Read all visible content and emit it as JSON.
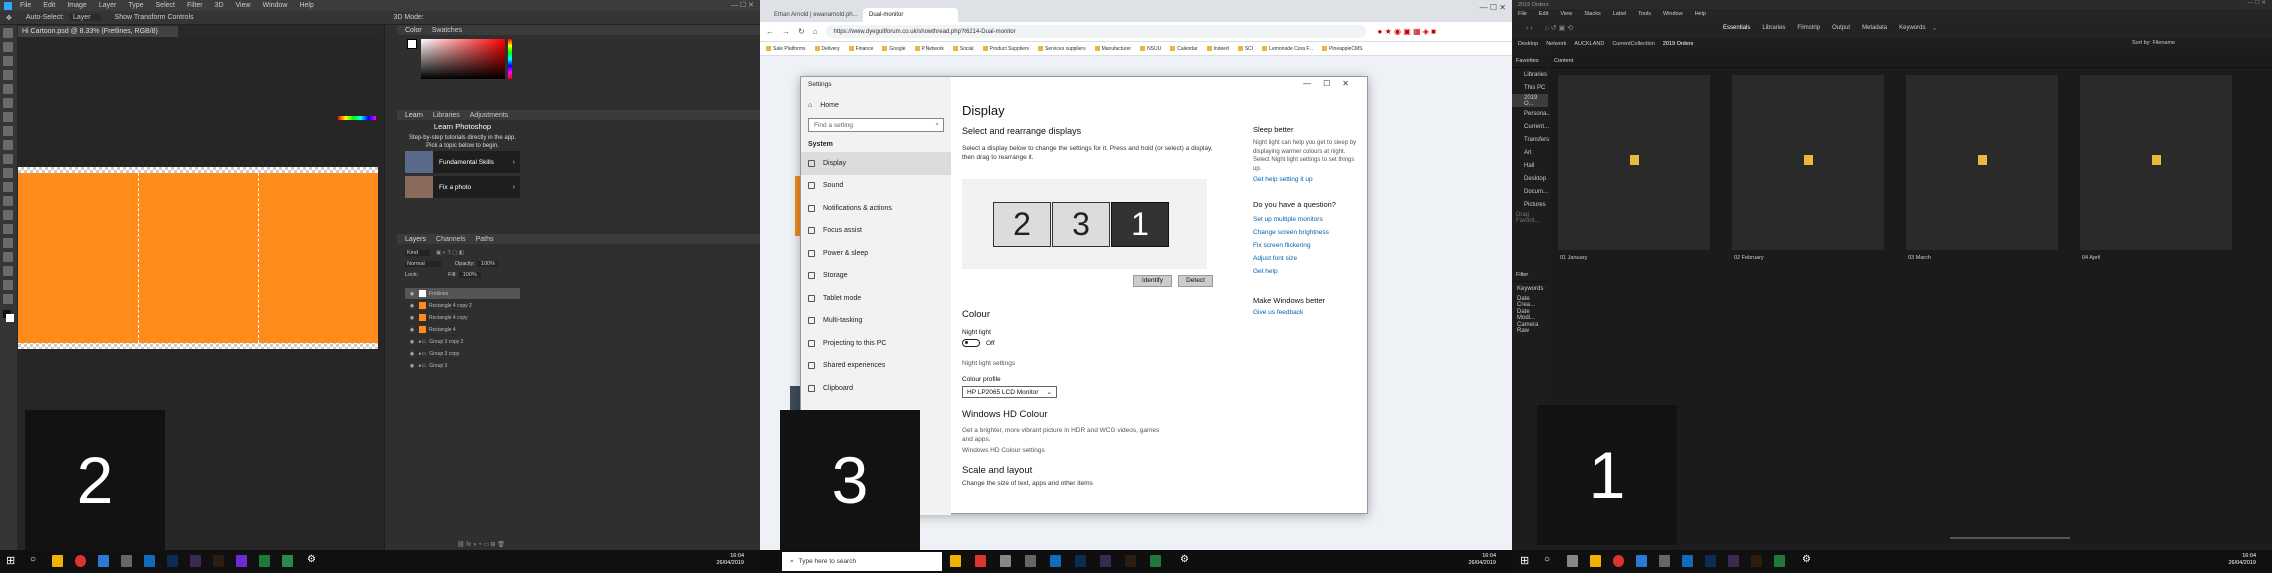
{
  "monitors": {
    "left": "2",
    "middle": "3",
    "right": "1"
  },
  "photoshop": {
    "menu": [
      "File",
      "Edit",
      "Image",
      "Layer",
      "Type",
      "Select",
      "Filter",
      "3D",
      "View",
      "Window",
      "Help"
    ],
    "options": {
      "auto_select": "Auto-Select:",
      "layer": "Layer",
      "transform": "Show Transform Controls",
      "mode3d": "3D Mode:"
    },
    "doc_tab": "Hi Cartoon.psd @ 8.33% (Fretlines, RGB/8)",
    "panels": {
      "color_tab": "Color",
      "swatches_tab": "Swatches",
      "learn_tab": "Learn",
      "libraries_tab": "Libraries",
      "adjustments_tab": "Adjustments",
      "layers_tab": "Layers",
      "channels_tab": "Channels",
      "paths_tab": "Paths"
    },
    "learn": {
      "title": "Learn Photoshop",
      "desc": "Step-by-step tutorials directly in the app. Pick a topic below to begin.",
      "cards": [
        "Fundamental Skills",
        "Fix a photo"
      ]
    },
    "layers_controls": {
      "kind": "Kind",
      "blend": "Normal",
      "opacity_label": "Opacity:",
      "opacity": "100%",
      "lock_label": "Lock:",
      "fill_label": "Fill:",
      "fill": "100%"
    },
    "layers": [
      "Fretlines",
      "Rectangle 4 copy 2",
      "Rectangle 4 copy",
      "Rectangle 4",
      "Group 3 copy 2",
      "Group 3 copy",
      "Group 3"
    ],
    "canvas_color": "#ff8c1a"
  },
  "chrome": {
    "tabs": [
      "Ethan Arnold | ewanarnold.ph...",
      "Dual-monitor"
    ],
    "url": "https://www.dyeguitforum.co.uk/showthread.php?t6214-Dual-monitor",
    "bookmarks": [
      "Sale Platforms",
      "Delivery",
      "Finance",
      "Google",
      "P.Network",
      "Social",
      "Product Suppliers",
      "Services suppliers",
      "Manufacturer",
      "NSUU",
      "Calendar",
      "Indeed",
      "SCI",
      "Lemonade Cora F...",
      "PineappleCMS"
    ]
  },
  "settings": {
    "title": "Settings",
    "home": "Home",
    "search_placeholder": "Find a setting",
    "section": "System",
    "nav": [
      "Display",
      "Sound",
      "Notifications & actions",
      "Focus assist",
      "Power & sleep",
      "Storage",
      "Tablet mode",
      "Multi-tasking",
      "Projecting to this PC",
      "Shared experiences",
      "Clipboard"
    ],
    "heading": "Display",
    "subheading": "Select and rearrange displays",
    "desc": "Select a display below to change the settings for it. Press and hold (or select) a display, then drag to rearrange it.",
    "displays": [
      "2",
      "3",
      "1"
    ],
    "identify": "Identify",
    "detect": "Detect",
    "colour_heading": "Colour",
    "night_light_label": "Night light",
    "night_light_state": "Off",
    "night_light_settings": "Night light settings",
    "colour_profile_label": "Colour profile",
    "colour_profile_value": "HP LP2065 LCD Monitor",
    "hd_heading": "Windows HD Colour",
    "hd_desc": "Get a brighter, more vibrant picture in HDR and WCG videos, games and apps.",
    "hd_link": "Windows HD Colour settings",
    "scale_heading": "Scale and layout",
    "scale_sub": "Change the size of text, apps and other items",
    "side": {
      "sleep_heading": "Sleep better",
      "sleep_desc": "Night light can help you get to sleep by displaying warmer colours at night. Select Night light settings to set things up.",
      "sleep_link": "Get help setting it up",
      "question_heading": "Do you have a question?",
      "question_links": [
        "Set up multiple monitors",
        "Change screen brightness",
        "Fix screen flickering",
        "Adjust font size",
        "Get help"
      ],
      "better_heading": "Make Windows better",
      "better_link": "Give us feedback"
    }
  },
  "lightroom": {
    "window_title": "2019 Orders",
    "menu": [
      "File",
      "Edit",
      "View",
      "Stacks",
      "Label",
      "Tools",
      "Window",
      "Help"
    ],
    "workspaces": [
      "Essentials",
      "Libraries",
      "Filmstrip",
      "Output",
      "Metadata",
      "Keywords"
    ],
    "path": [
      "Desktop",
      "Network",
      "AUCKLAND",
      "CurrentCollection",
      "2019 Orders"
    ],
    "sort": "Sort by: Filename",
    "favorites_heading": "Favorites",
    "favorites": [
      "Libraries",
      "This PC",
      "2019 O...",
      "Persona...",
      "Current...",
      "Transfers",
      "Art",
      "Hall",
      "Desktop",
      "Docum...",
      "Pictures",
      "Drag Favorit..."
    ],
    "content_heading": "Content",
    "folders": [
      "01 January",
      "02 February",
      "03 March",
      "04 April"
    ],
    "filter_heading": "Filter",
    "filters": [
      "Keywords",
      "Date Crea...",
      "Date Modi...",
      "Camera Raw"
    ]
  },
  "taskbar": {
    "search_placeholder": "Type here to search",
    "time": "16:04",
    "date": "26/04/2019"
  }
}
